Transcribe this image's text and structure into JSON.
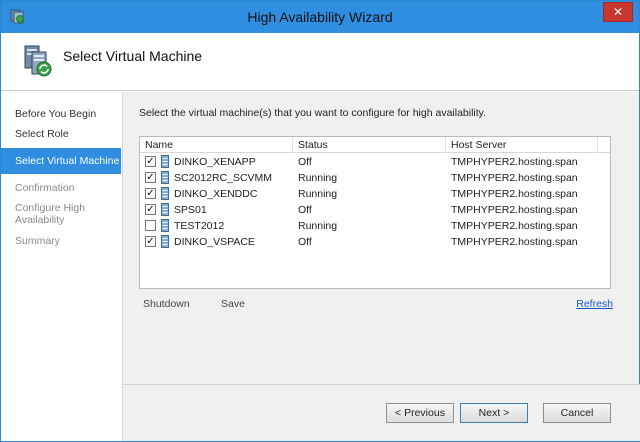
{
  "window": {
    "title": "High Availability Wizard",
    "close_label": "✕"
  },
  "header": {
    "title": "Select Virtual Machine"
  },
  "nav": {
    "items": [
      {
        "label": "Before You Begin",
        "state": "done"
      },
      {
        "label": "Select Role",
        "state": "done"
      },
      {
        "label": "Select Virtual Machine",
        "state": "active"
      },
      {
        "label": "Confirmation",
        "state": "disabled"
      },
      {
        "label": "Configure High Availability",
        "state": "disabled"
      },
      {
        "label": "Summary",
        "state": "disabled"
      }
    ]
  },
  "main": {
    "instruction": "Select the virtual machine(s) that you want to configure for high availability.",
    "table": {
      "columns": [
        "Name",
        "Status",
        "Host Server"
      ],
      "rows": [
        {
          "checked": true,
          "name": "DINKO_XENAPP",
          "status": "Off",
          "host": "TMPHYPER2.hosting.span"
        },
        {
          "checked": true,
          "name": "SC2012RC_SCVMM",
          "status": "Running",
          "host": "TMPHYPER2.hosting.span"
        },
        {
          "checked": true,
          "name": "DINKO_XENDDC",
          "status": "Running",
          "host": "TMPHYPER2.hosting.span"
        },
        {
          "checked": true,
          "name": "SPS01",
          "status": "Off",
          "host": "TMPHYPER2.hosting.span"
        },
        {
          "checked": false,
          "name": "TEST2012",
          "status": "Running",
          "host": "TMPHYPER2.hosting.span"
        },
        {
          "checked": true,
          "name": "DINKO_VSPACE",
          "status": "Off",
          "host": "TMPHYPER2.hosting.span"
        }
      ]
    },
    "actions": {
      "shutdown": "Shutdown",
      "save": "Save",
      "refresh": "Refresh"
    }
  },
  "footer": {
    "previous": "< Previous",
    "next": "Next >",
    "cancel": "Cancel"
  },
  "colors": {
    "titlebar": "#2f8ee0",
    "nav_active": "#2f8ee0",
    "close_button": "#c7372f",
    "link": "#1a56c8"
  },
  "icons": {
    "app": "cluster-icon",
    "header": "cluster-server-icon",
    "vm": "server-icon",
    "checkbox": "checkmark-icon"
  }
}
